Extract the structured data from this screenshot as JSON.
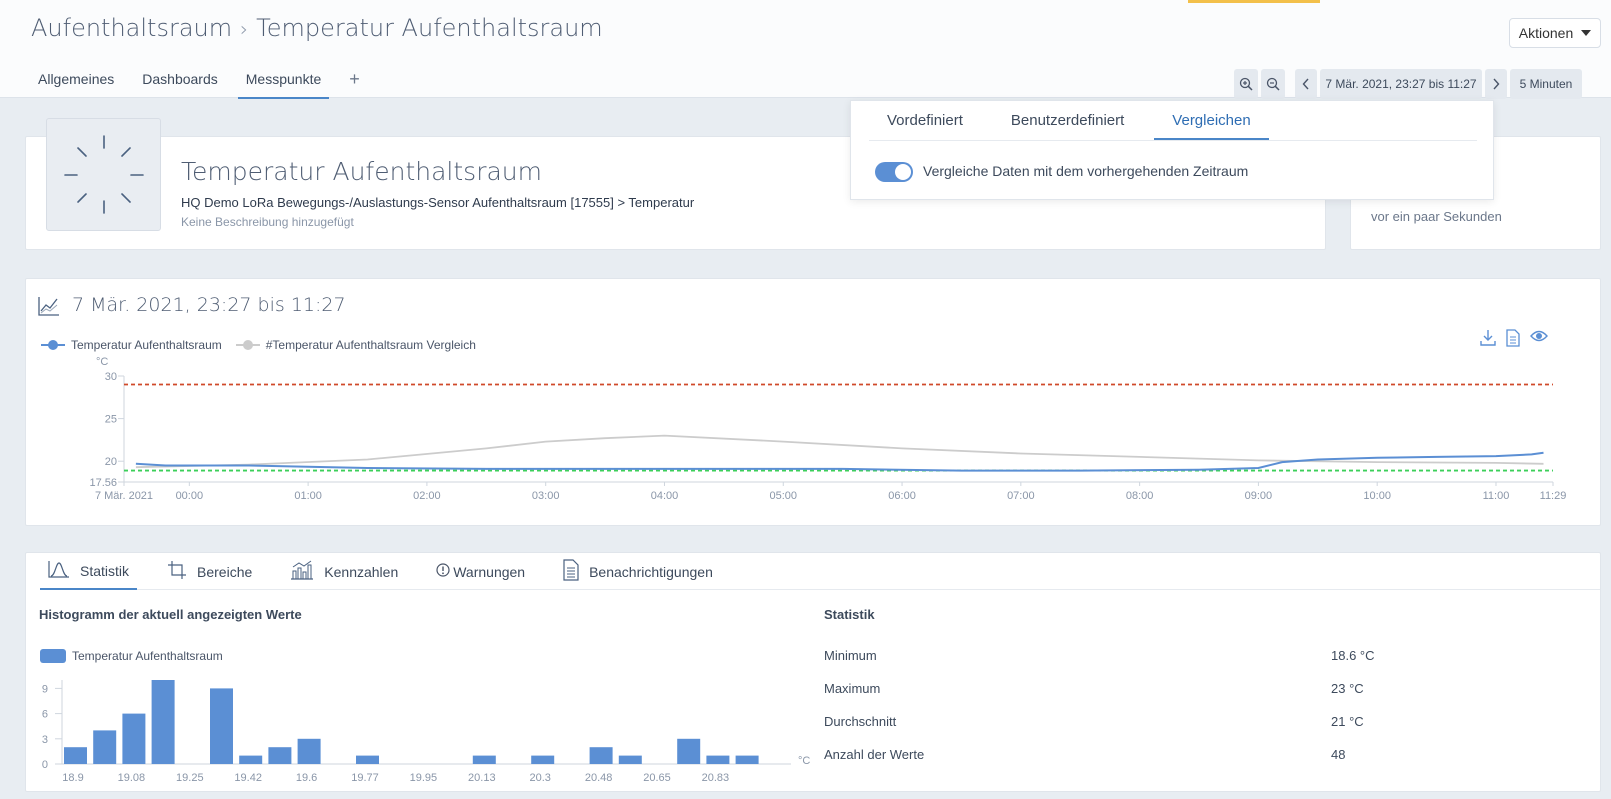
{
  "breadcrumb": {
    "parent": "Aufenthaltsraum",
    "separator": "›",
    "current": "Temperatur Aufenthaltsraum"
  },
  "actions_label": "Aktionen",
  "tabs": [
    {
      "label": "Allgemeines",
      "active": false
    },
    {
      "label": "Dashboards",
      "active": false
    },
    {
      "label": "Messpunkte",
      "active": true
    }
  ],
  "add_tab": "+",
  "timebar": {
    "range": "7 Mär. 2021, 23:27 bis 11:27",
    "interval": "5 Minuten"
  },
  "popover": {
    "tabs": [
      {
        "label": "Vordefiniert",
        "active": false
      },
      {
        "label": "Benutzerdefiniert",
        "active": false
      },
      {
        "label": "Vergleichen",
        "active": true
      }
    ],
    "toggle_label": "Vergleiche Daten mit dem vorhergehenden Zeitraum",
    "toggle_on": true
  },
  "info": {
    "title": "Temperatur Aufenthaltsraum",
    "path": "HQ Demo LoRa Bewegungs-/Auslastungs-Sensor Aufenthaltsraum [17555] > Temperatur",
    "description": "Keine Beschreibung hinzugefügt",
    "last_update": "vor ein paar Sekunden"
  },
  "chart_title": "7 Mär. 2021, 23:27 bis 11:27",
  "chart_data": [
    {
      "type": "line",
      "ylabel": "°C",
      "ylim": [
        17.56,
        30
      ],
      "yticks": [
        30,
        25,
        20,
        17.56
      ],
      "x_ticks": [
        "7 Mär. 2021",
        "00:00",
        "01:00",
        "02:00",
        "03:00",
        "04:00",
        "05:00",
        "06:00",
        "07:00",
        "08:00",
        "09:00",
        "10:00",
        "11:00",
        "11:29"
      ],
      "x_tick_hours": [
        -0.55,
        0,
        1,
        2,
        3,
        4,
        5,
        6,
        7,
        8,
        9,
        10,
        11,
        11.48
      ],
      "thresholds": {
        "upper": 29,
        "lower": 18.9,
        "upper_color": "#d04a2a",
        "lower_color": "#3ccf5a"
      },
      "series": [
        {
          "name": "Temperatur Aufenthaltsraum",
          "color": "#5b8fd4",
          "x": [
            -0.45,
            -0.2,
            0.5,
            1.5,
            2.5,
            3.5,
            4.5,
            5.5,
            6.5,
            7.5,
            8.5,
            9.0,
            9.2,
            9.5,
            10.0,
            10.5,
            11.0,
            11.3,
            11.4
          ],
          "y": [
            19.7,
            19.5,
            19.5,
            19.2,
            19.1,
            19.1,
            19.1,
            19.1,
            18.9,
            18.9,
            19.0,
            19.2,
            19.9,
            20.2,
            20.4,
            20.5,
            20.6,
            20.8,
            21.0
          ]
        },
        {
          "name": "#Temperatur Aufenthaltsraum Vergleich",
          "color": "#cccccc",
          "x": [
            -0.45,
            0.5,
            1.5,
            2.5,
            3.0,
            3.5,
            4.0,
            5.0,
            6.0,
            7.0,
            8.0,
            9.0,
            10.0,
            11.0,
            11.4
          ],
          "y": [
            19.3,
            19.6,
            20.2,
            21.5,
            22.3,
            22.7,
            23.0,
            22.3,
            21.5,
            20.9,
            20.5,
            20.1,
            19.9,
            19.8,
            19.7
          ]
        }
      ]
    },
    {
      "type": "bar",
      "title": "Histogramm der aktuell angezeigten Werte",
      "series_name": "Temperatur Aufenthaltsraum",
      "xlabel": "°C",
      "yticks": [
        0,
        3,
        6,
        9
      ],
      "ylim": [
        0,
        10
      ],
      "x_tick_labels": [
        "18.9",
        "19.08",
        "19.25",
        "19.42",
        "19.6",
        "19.77",
        "19.95",
        "20.13",
        "20.3",
        "20.48",
        "20.65",
        "20.83"
      ],
      "values": [
        2,
        4,
        6,
        10,
        0,
        9,
        1,
        2,
        3,
        0,
        1,
        0,
        0,
        0,
        1,
        0,
        1,
        0,
        2,
        1,
        0,
        3,
        1,
        1
      ]
    }
  ],
  "stats_tabs": [
    {
      "label": "Statistik",
      "icon": "distribution-icon",
      "active": true
    },
    {
      "label": "Bereiche",
      "icon": "crop-icon",
      "active": false
    },
    {
      "label": "Kennzahlen",
      "icon": "bar-chart-icon",
      "active": false
    },
    {
      "label": "Warnungen",
      "icon": "warning-icon",
      "active": false
    },
    {
      "label": "Benachrichtigungen",
      "icon": "document-icon",
      "active": false
    }
  ],
  "statistics": {
    "title": "Statistik",
    "rows": [
      {
        "label": "Minimum",
        "value": "18.6 °C"
      },
      {
        "label": "Maximum",
        "value": "23 °C"
      },
      {
        "label": "Durchschnitt",
        "value": "21 °C"
      },
      {
        "label": "Anzahl der Werte",
        "value": "48"
      }
    ]
  }
}
